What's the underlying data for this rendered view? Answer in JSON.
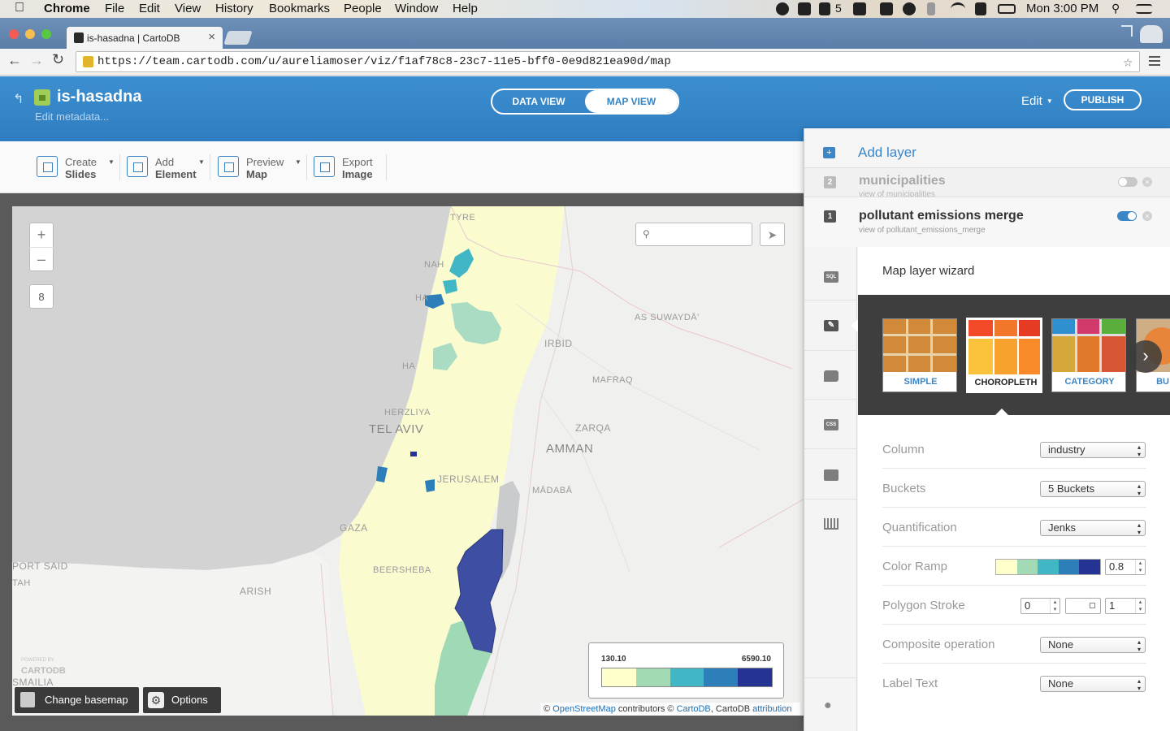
{
  "macbar": {
    "apple": "",
    "app": "Chrome",
    "menus": [
      "File",
      "Edit",
      "View",
      "History",
      "Bookmarks",
      "People",
      "Window",
      "Help"
    ],
    "tray_badge": "5",
    "clock": "Mon 3:00 PM"
  },
  "browser": {
    "tab_title": "is-hasadna | CartoDB",
    "tab_close": "×",
    "url": "https://team.cartodb.com/u/aureliamoser/viz/f1af78c8-23c7-11e5-bff0-0e9d821ea90d/map"
  },
  "header": {
    "back_glyph": "↰",
    "viz_name": "is-hasadna",
    "edit_metadata": "Edit metadata...",
    "data_view": "DATA VIEW",
    "map_view": "MAP VIEW",
    "edit": "Edit",
    "publish": "PUBLISH"
  },
  "toolbar": {
    "items": [
      {
        "line1": "Create",
        "line2": "Slides"
      },
      {
        "line1": "Add",
        "line2": "Element"
      },
      {
        "line1": "Preview",
        "line2": "Map"
      },
      {
        "line1": "Export",
        "line2": "Image"
      }
    ]
  },
  "map": {
    "zoom_in": "+",
    "zoom_out": "–",
    "zoom_level": "8",
    "labels": {
      "tyre": "TYRE",
      "nah": "NAH",
      "haifa": "HA",
      "had": "HA",
      "irbid": "IRBID",
      "suwayda": "AS SUWAYDĀ'",
      "mafraq": "MAFRAQ",
      "herzliya": "HERZLIYA",
      "telaviv": "TEL AVIV",
      "zarqa": "ZARQA",
      "amman": "AMMAN",
      "jerusalem": "JERUSALEM",
      "madaba": "MĀDABĀ",
      "gaza": "GAZA",
      "beersheba": "BEERSHEBA",
      "portsaid": "PORT SAID",
      "tah": "TAH",
      "arish": "ARISH",
      "smailia": "SMAILIA"
    },
    "watermark_small": "POWERED BY",
    "watermark": "CARTODB",
    "legend": {
      "min": "130.10",
      "max": "6590.10",
      "colors": [
        "#ffffcc",
        "#a1dab4",
        "#41b6c4",
        "#2c7fb8",
        "#253494"
      ]
    },
    "change_basemap": "Change basemap",
    "options": "Options",
    "attribution": {
      "copy1": "©",
      "osm": "OpenStreetMap",
      "mid": "contributors ©",
      "cartodb": "CartoDB",
      "rest": ", CartoDB",
      "attr": "attribution"
    }
  },
  "panel": {
    "add_layer": "Add layer",
    "layers": [
      {
        "num": "2",
        "name": "municipalities",
        "sub": "view of municipalities",
        "enabled": false
      },
      {
        "num": "1",
        "name": "pollutant emissions merge",
        "sub": "view of pollutant_emissions_merge",
        "enabled": true
      }
    ],
    "side_icons": [
      "SQL",
      "wizard",
      "infowindow",
      "CSS",
      "legend",
      "filters",
      "lightbulb"
    ],
    "wizard_title": "Map layer wizard",
    "wizard_types": [
      "SIMPLE",
      "CHOROPLETH",
      "CATEGORY",
      "BU"
    ],
    "wizard_selected": "CHOROPLETH",
    "next_glyph": "›",
    "props": {
      "column_label": "Column",
      "column_value": "industry",
      "buckets_label": "Buckets",
      "buckets_value": "5 Buckets",
      "quant_label": "Quantification",
      "quant_value": "Jenks",
      "ramp_label": "Color Ramp",
      "ramp_colors": [
        "#ffffcc",
        "#a1dab4",
        "#41b6c4",
        "#2c7fb8",
        "#253494"
      ],
      "ramp_opacity": "0.8",
      "stroke_label": "Polygon Stroke",
      "stroke_width": "0",
      "stroke_opacity": "1",
      "composite_label": "Composite operation",
      "composite_value": "None",
      "label_text_label": "Label Text",
      "label_text_value": "None"
    }
  }
}
